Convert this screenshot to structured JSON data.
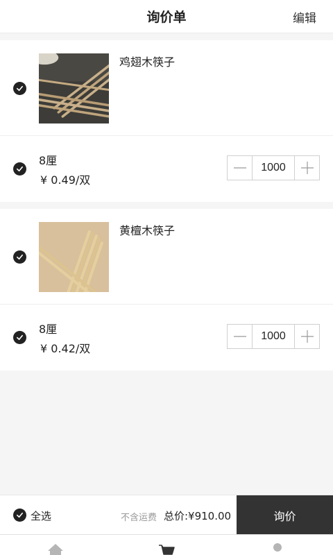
{
  "header": {
    "title": "询价单",
    "edit_label": "编辑"
  },
  "items": [
    {
      "name": "鸡翅木筷子",
      "image_icon": "wooden-chopsticks-photo",
      "spec": "8厘",
      "price": "¥ 0.49/双",
      "quantity": "1000",
      "checked": true
    },
    {
      "name": "黄檀木筷子",
      "image_icon": "bamboo-chopsticks-photo",
      "spec": "8厘",
      "price": "¥ 0.42/双",
      "quantity": "1000",
      "checked": true
    }
  ],
  "footer": {
    "select_all_label": "全选",
    "shipping_note": "不含运费",
    "total_label": "总价:¥910.00",
    "inquiry_button": "询价"
  },
  "tabbar": [
    "home-icon",
    "cart-icon",
    "user-icon"
  ],
  "colors": {
    "accent_dark": "#333333",
    "background": "#f5f5f5",
    "muted_text": "#999999"
  }
}
